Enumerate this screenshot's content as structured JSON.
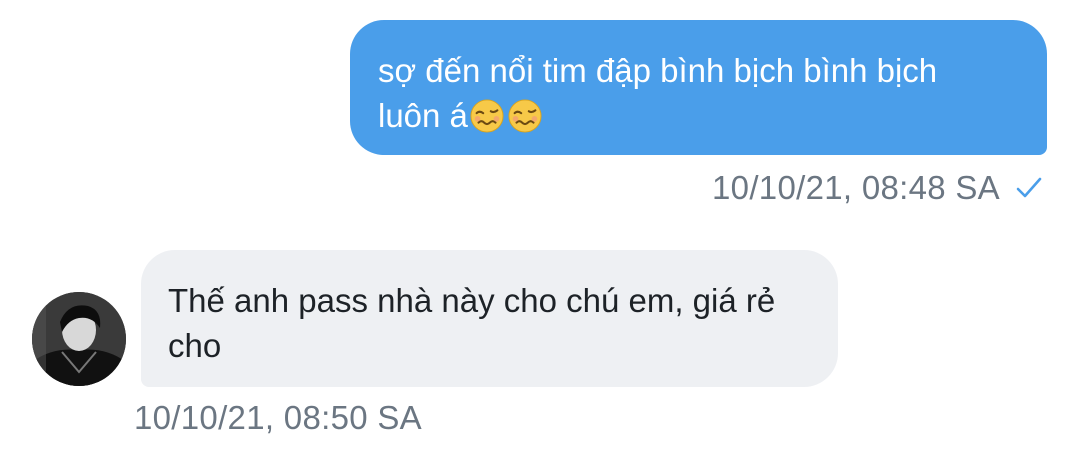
{
  "conversation": {
    "messages": [
      {
        "direction": "outgoing",
        "text": "sợ đến nổi tim đập bình bịch bình bịch luôn á",
        "emojis": [
          "woozy-face-icon",
          "woozy-face-icon"
        ],
        "timestamp": "10/10/21, 08:48 SA",
        "status_icon": "check-icon"
      },
      {
        "direction": "incoming",
        "text": "Thế anh pass nhà này cho chú em, giá rẻ cho",
        "timestamp": "10/10/21, 08:50 SA"
      }
    ]
  },
  "colors": {
    "outgoing_bubble": "#4a9eea",
    "incoming_bubble": "#eef0f3",
    "timestamp_text": "#6b7682",
    "check_mark": "#4a9eea"
  }
}
